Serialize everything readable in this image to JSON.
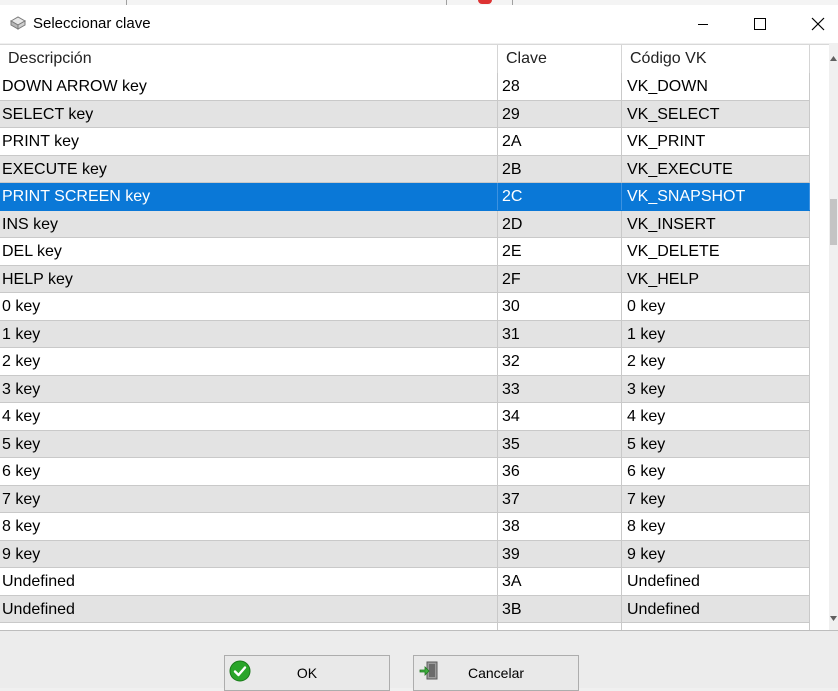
{
  "window": {
    "title": "Seleccionar clave",
    "minimize_icon": "minimize-icon",
    "maximize_icon": "maximize-icon",
    "close_icon": "close-icon"
  },
  "table": {
    "headers": [
      "Descripción",
      "Clave",
      "Código VK"
    ],
    "selected_index": 4,
    "rows": [
      {
        "desc": "DOWN ARROW key",
        "key": "28",
        "vk": "VK_DOWN"
      },
      {
        "desc": "SELECT key",
        "key": "29",
        "vk": "VK_SELECT"
      },
      {
        "desc": "PRINT key",
        "key": "2A",
        "vk": "VK_PRINT"
      },
      {
        "desc": "EXECUTE key",
        "key": "2B",
        "vk": "VK_EXECUTE"
      },
      {
        "desc": "PRINT SCREEN key",
        "key": "2C",
        "vk": "VK_SNAPSHOT"
      },
      {
        "desc": "INS key",
        "key": "2D",
        "vk": "VK_INSERT"
      },
      {
        "desc": "DEL key",
        "key": "2E",
        "vk": "VK_DELETE"
      },
      {
        "desc": "HELP key",
        "key": "2F",
        "vk": "VK_HELP"
      },
      {
        "desc": "0 key",
        "key": "30",
        "vk": "0 key"
      },
      {
        "desc": "1 key",
        "key": "31",
        "vk": "1 key"
      },
      {
        "desc": "2 key",
        "key": "32",
        "vk": "2 key"
      },
      {
        "desc": "3 key",
        "key": "33",
        "vk": "3 key"
      },
      {
        "desc": "4 key",
        "key": "34",
        "vk": "4 key"
      },
      {
        "desc": "5 key",
        "key": "35",
        "vk": "5 key"
      },
      {
        "desc": "6 key",
        "key": "36",
        "vk": "6 key"
      },
      {
        "desc": "7 key",
        "key": "37",
        "vk": "7 key"
      },
      {
        "desc": "8 key",
        "key": "38",
        "vk": "8 key"
      },
      {
        "desc": "9 key",
        "key": "39",
        "vk": "9 key"
      },
      {
        "desc": "Undefined",
        "key": "3A",
        "vk": "Undefined"
      },
      {
        "desc": "Undefined",
        "key": "3B",
        "vk": "Undefined"
      },
      {
        "desc": "",
        "key": "",
        "vk": ""
      }
    ]
  },
  "buttons": {
    "ok_label": "OK",
    "ok_icon": "check-icon",
    "cancel_label": "Cancelar",
    "cancel_icon": "exit-door-icon"
  },
  "colors": {
    "selection": "#0a78d7",
    "alt_row": "#e3e3e3"
  }
}
